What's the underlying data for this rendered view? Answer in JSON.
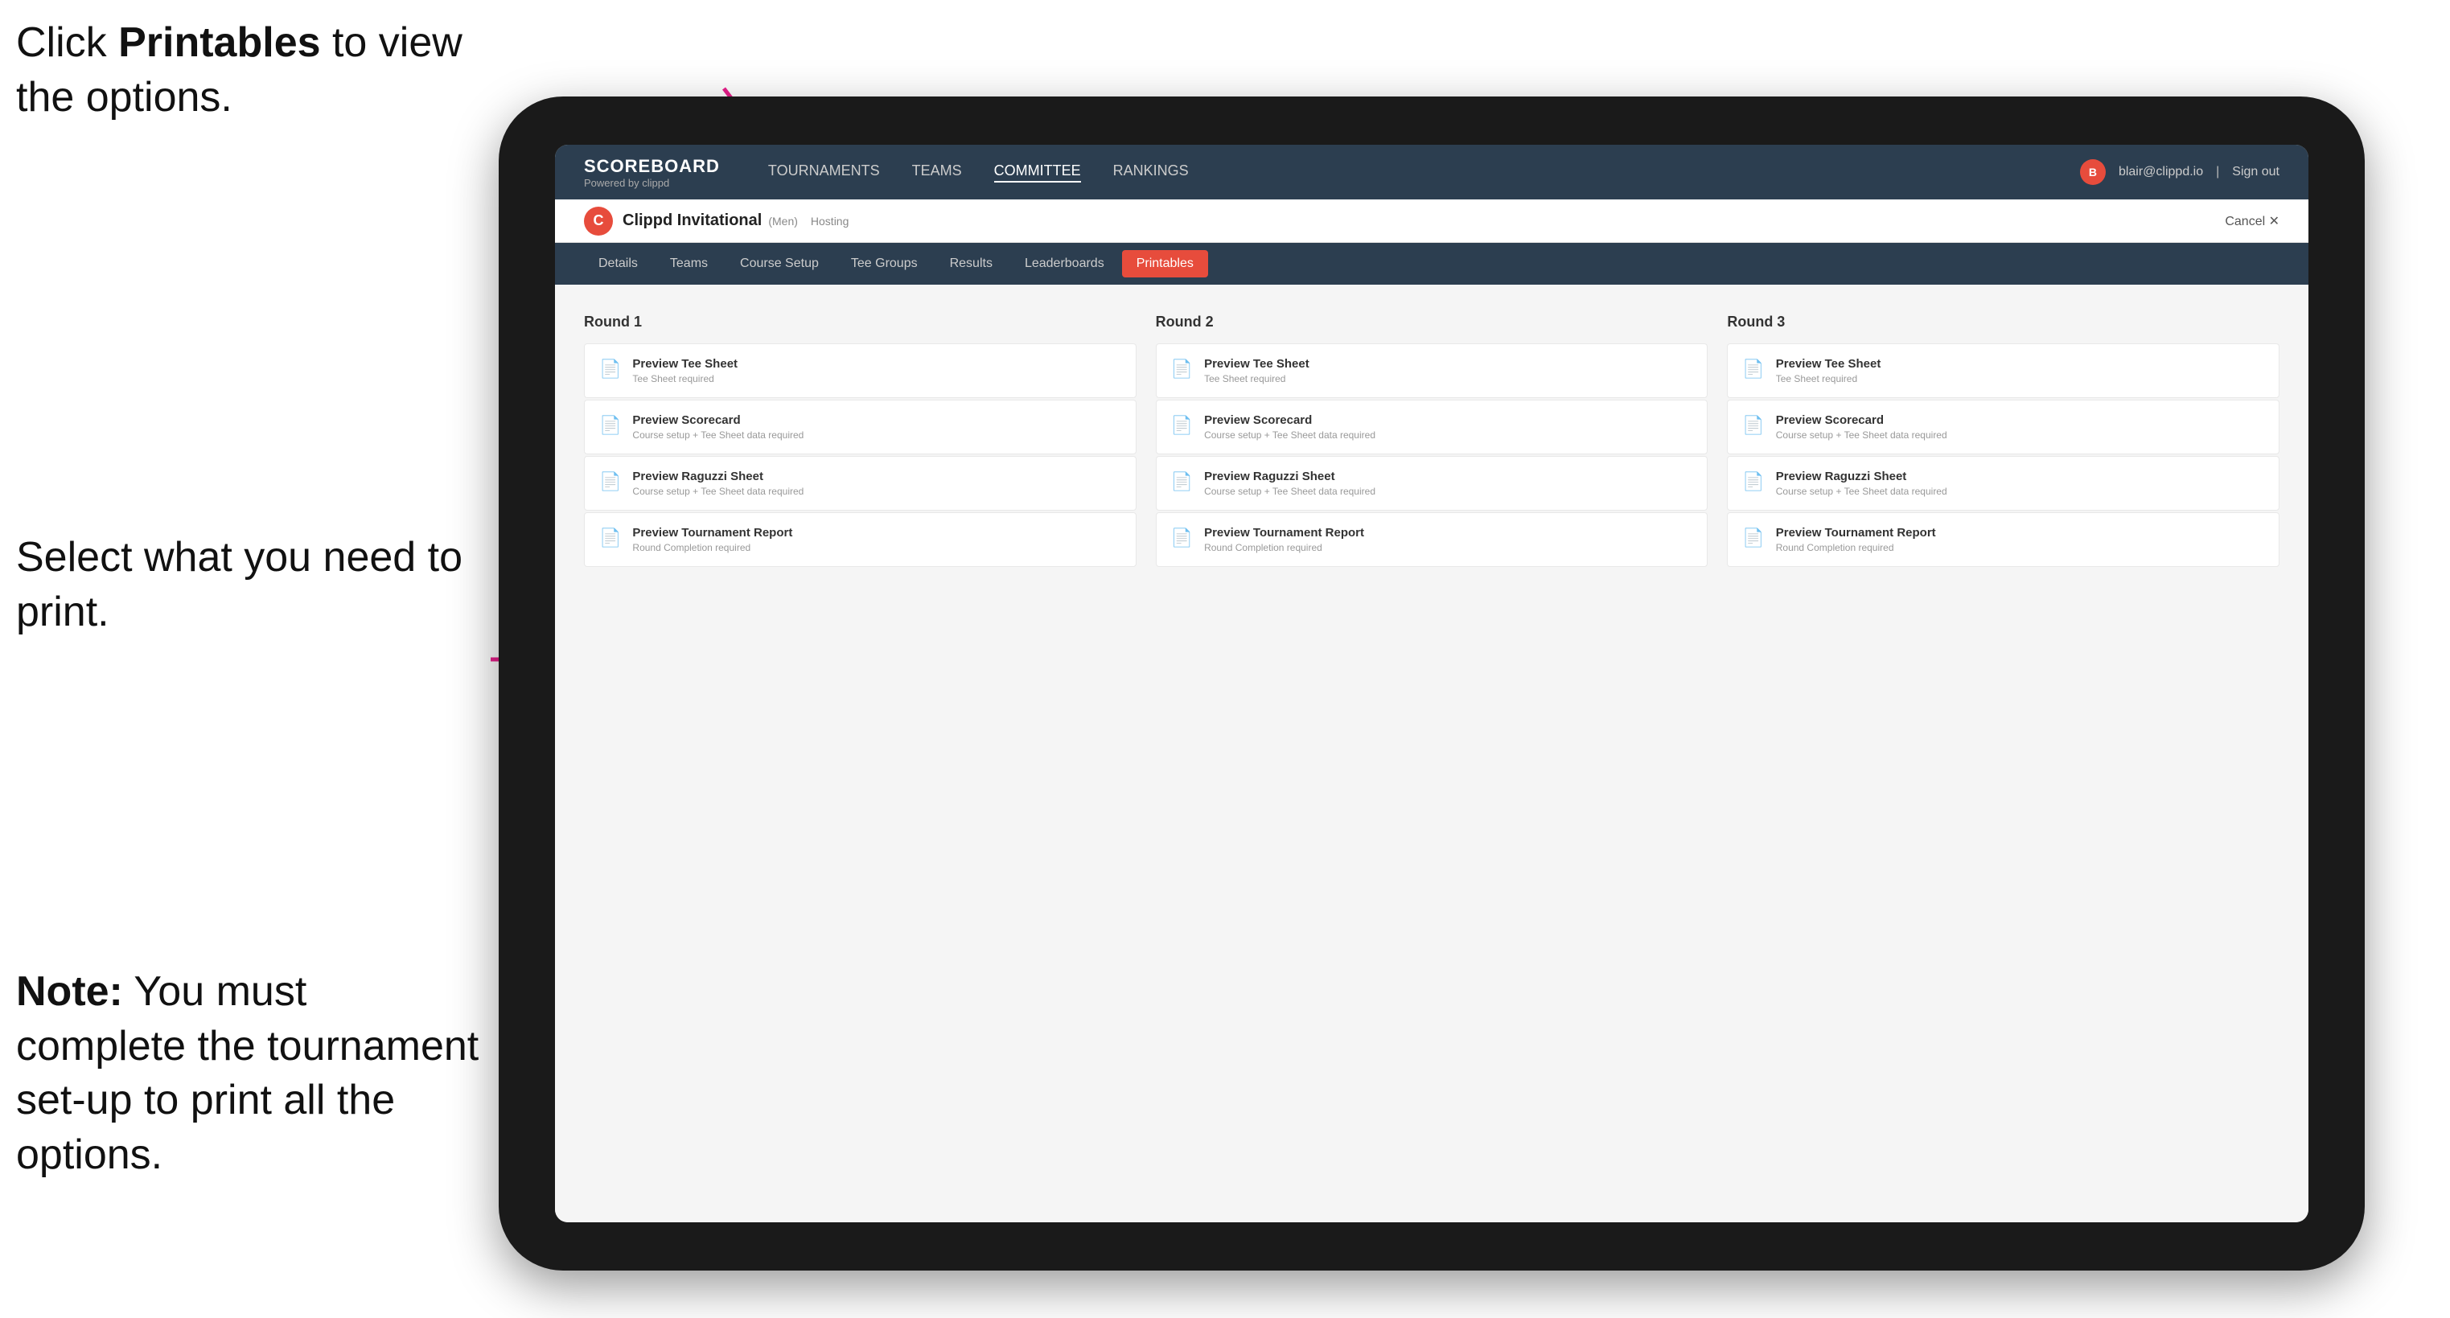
{
  "annotations": {
    "top": {
      "line1": "Click ",
      "bold": "Printables",
      "line2": " to\nview the options."
    },
    "middle": {
      "text": "Select what you\nneed to print."
    },
    "bottom": {
      "bold": "Note:",
      "text": " You must\ncomplete the\ntournament set-up\nto print all the options."
    }
  },
  "topNav": {
    "logo": "SCOREBOARD",
    "logoSub": "Powered by clippd",
    "links": [
      "TOURNAMENTS",
      "TEAMS",
      "COMMITTEE",
      "RANKINGS"
    ],
    "activeLink": "COMMITTEE",
    "userEmail": "blair@clippd.io",
    "signOut": "Sign out"
  },
  "tournamentBar": {
    "logo": "C",
    "name": "Clippd Invitational",
    "tag": "(Men)",
    "hosting": "Hosting",
    "cancel": "Cancel ✕"
  },
  "subNav": {
    "tabs": [
      "Details",
      "Teams",
      "Course Setup",
      "Tee Groups",
      "Results",
      "Leaderboards",
      "Printables"
    ],
    "activeTab": "Printables"
  },
  "rounds": [
    {
      "label": "Round 1",
      "cards": [
        {
          "title": "Preview Tee Sheet",
          "sub": "Tee Sheet required"
        },
        {
          "title": "Preview Scorecard",
          "sub": "Course setup + Tee Sheet data required"
        },
        {
          "title": "Preview Raguzzi Sheet",
          "sub": "Course setup + Tee Sheet data required"
        },
        {
          "title": "Preview Tournament Report",
          "sub": "Round Completion required"
        }
      ]
    },
    {
      "label": "Round 2",
      "cards": [
        {
          "title": "Preview Tee Sheet",
          "sub": "Tee Sheet required"
        },
        {
          "title": "Preview Scorecard",
          "sub": "Course setup + Tee Sheet data required"
        },
        {
          "title": "Preview Raguzzi Sheet",
          "sub": "Course setup + Tee Sheet data required"
        },
        {
          "title": "Preview Tournament Report",
          "sub": "Round Completion required"
        }
      ]
    },
    {
      "label": "Round 3",
      "cards": [
        {
          "title": "Preview Tee Sheet",
          "sub": "Tee Sheet required"
        },
        {
          "title": "Preview Scorecard",
          "sub": "Course setup + Tee Sheet data required"
        },
        {
          "title": "Preview Raguzzi Sheet",
          "sub": "Course setup + Tee Sheet data required"
        },
        {
          "title": "Preview Tournament Report",
          "sub": "Round Completion required"
        }
      ]
    }
  ]
}
